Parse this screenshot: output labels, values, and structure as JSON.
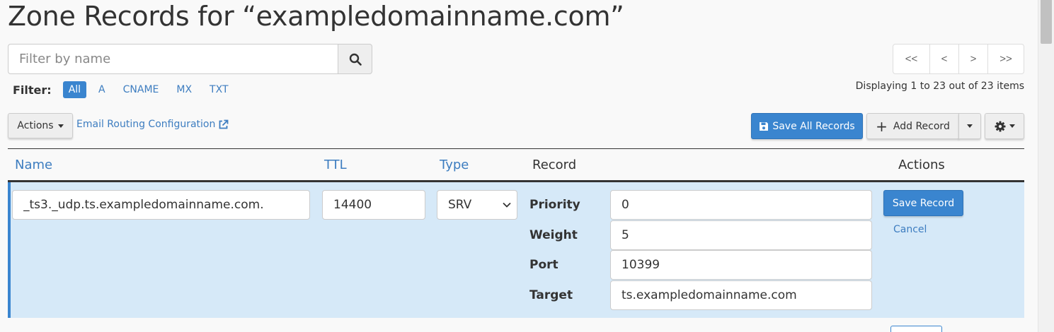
{
  "page": {
    "title": "Zone Records for “exampledomainname.com”"
  },
  "search": {
    "placeholder": "Filter by name",
    "value": ""
  },
  "filter": {
    "label": "Filter:",
    "options": [
      "All",
      "A",
      "CNAME",
      "MX",
      "TXT"
    ],
    "active": "All"
  },
  "pagination": {
    "first": "<<",
    "prev": "<",
    "next": ">",
    "last": ">>",
    "status": "Displaying 1 to 23 out of 23 items"
  },
  "toolbar": {
    "actions_label": "Actions",
    "email_routing_label": "Email Routing Configuration",
    "save_all_label": "Save All Records",
    "add_record_label": "Add Record"
  },
  "table": {
    "columns": {
      "name": "Name",
      "ttl": "TTL",
      "type": "Type",
      "record": "Record",
      "actions": "Actions"
    },
    "editing_row": {
      "name": "_ts3._udp.ts.exampledomainname.com.",
      "ttl": "14400",
      "type": "SRV",
      "fields": [
        {
          "label": "Priority",
          "value": "0"
        },
        {
          "label": "Weight",
          "value": "5"
        },
        {
          "label": "Port",
          "value": "10399"
        },
        {
          "label": "Target",
          "value": "ts.exampledomainname.com"
        }
      ],
      "save_label": "Save Record",
      "cancel_label": "Cancel"
    }
  },
  "colors": {
    "accent": "#3a85cf",
    "link": "#3d7dc0",
    "row_highlight": "#d6e9f8"
  },
  "icons": {
    "search": "search-icon",
    "external": "external-link-icon",
    "save": "floppy-disk-icon",
    "add": "plus-icon",
    "settings": "gear-icon",
    "dropdown": "chevron-down-icon"
  }
}
